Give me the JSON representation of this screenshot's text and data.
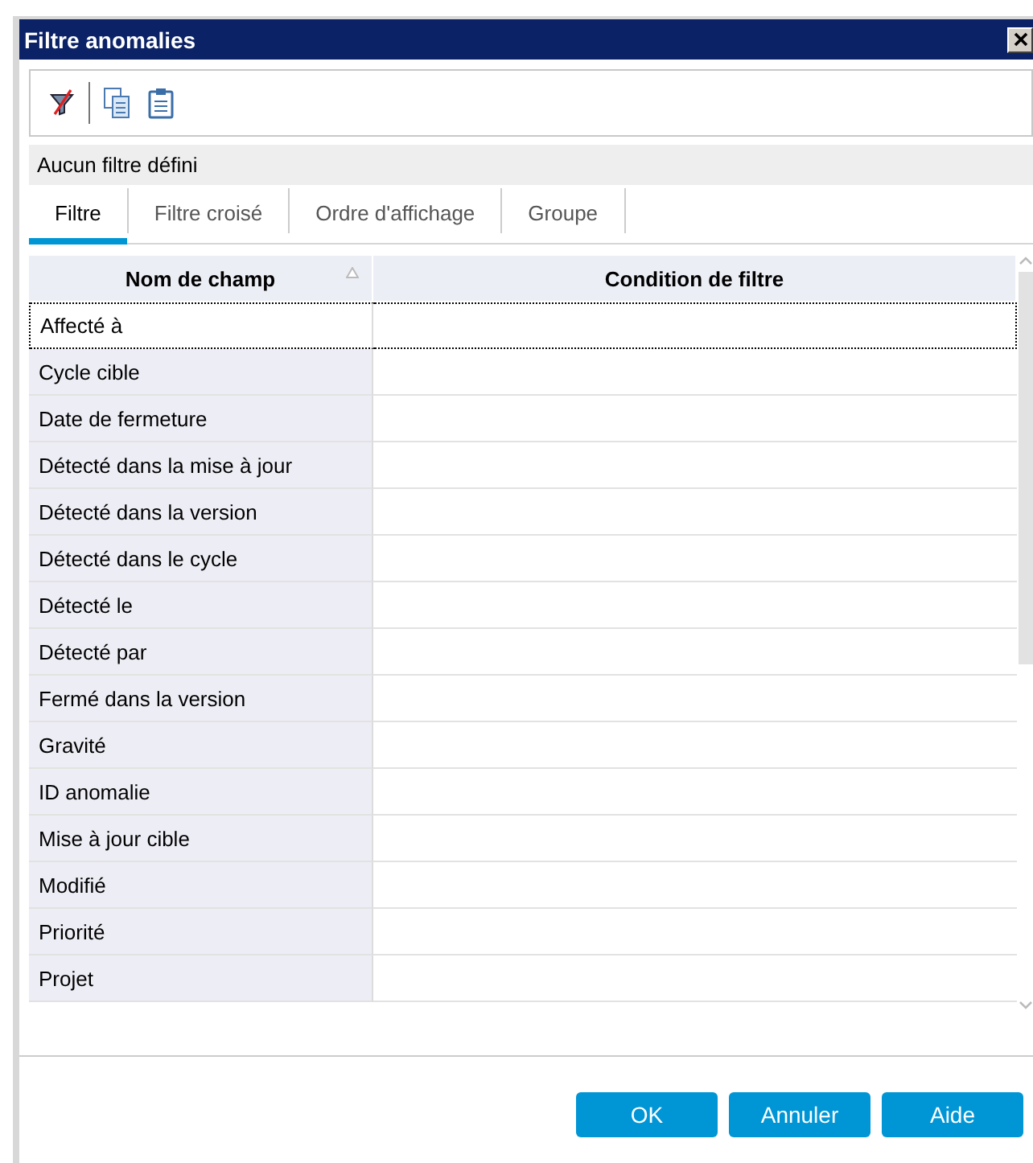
{
  "window": {
    "title": "Filtre anomalies"
  },
  "status": "Aucun filtre défini",
  "tabs": [
    {
      "label": "Filtre",
      "selected": true
    },
    {
      "label": "Filtre croisé",
      "selected": false
    },
    {
      "label": "Ordre d'affichage",
      "selected": false
    },
    {
      "label": "Groupe",
      "selected": false
    }
  ],
  "table": {
    "columns": [
      "Nom de champ",
      "Condition de filtre"
    ],
    "rows": [
      {
        "field": "Affecté à",
        "selected": true
      },
      {
        "field": "Cycle cible",
        "selected": false
      },
      {
        "field": "Date de fermeture",
        "selected": false
      },
      {
        "field": "Détecté dans la mise à jour",
        "selected": false
      },
      {
        "field": "Détecté dans la version",
        "selected": false
      },
      {
        "field": "Détecté dans le cycle",
        "selected": false
      },
      {
        "field": "Détecté le",
        "selected": false
      },
      {
        "field": "Détecté par",
        "selected": false
      },
      {
        "field": "Fermé dans la version",
        "selected": false
      },
      {
        "field": "Gravité",
        "selected": false
      },
      {
        "field": "ID anomalie",
        "selected": false
      },
      {
        "field": "Mise à jour cible",
        "selected": false
      },
      {
        "field": "Modifié",
        "selected": false
      },
      {
        "field": "Priorité",
        "selected": false
      },
      {
        "field": "Projet",
        "selected": false
      }
    ]
  },
  "buttons": [
    "OK",
    "Annuler",
    "Aide"
  ]
}
